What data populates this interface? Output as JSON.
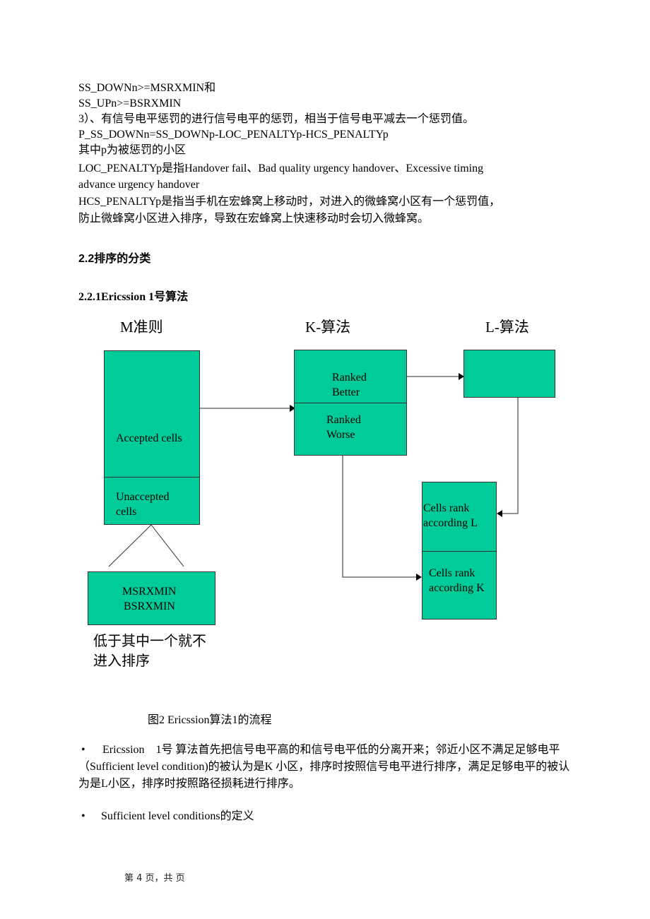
{
  "text_lines": [
    "SS_DOWNn>=MSRXMIN和",
    "SS_UPn>=BSRXMIN",
    "3）、有信号电平惩罚的进行信号电平的惩罚，相当于信号电平减去一个惩罚值。",
    "P_SS_DOWNn=SS_DOWNp-LOC_PENALTYp-HCS_PENALTYp",
    "其中p为被惩罚的小区",
    "LOC_PENALTYp是指Handover fail、Bad quality urgency handover、Excessive timing",
    "advance urgency handover",
    "HCS_PENALTYp是指当手机在宏蜂窝上移动时，对进入的微蜂窝小区有一个惩罚值，",
    "防止微蜂窝小区进入排序，导致在宏蜂窝上快速移动时会切入微蜂窝。"
  ],
  "section_heading": "2.2排序的分类",
  "subsection_heading": "2.2.1Ericssion 1号算法",
  "diagram": {
    "fill_color": "#00cc99",
    "column_titles": {
      "m": "M准则",
      "k": "K-算法",
      "l": "L-算法"
    },
    "m_box": {
      "accepted": "Accepted cells",
      "unaccepted_1": "Unaccepted",
      "unaccepted_2": "cells"
    },
    "threshold_box": {
      "line1": "MSRXMIN",
      "line2": "BSRXMIN"
    },
    "threshold_note": {
      "line1": "低于其中一个就不",
      "line2": "进入排序"
    },
    "k_box": {
      "better_1": "Ranked",
      "better_2": "Better",
      "worse_1": "Ranked",
      "worse_2": "Worse"
    },
    "result_box": {
      "l_1": "Cells rank",
      "l_2": "according L",
      "k_1": "Cells rank",
      "k_2": "according K"
    }
  },
  "caption": "图2 Ericssion算法1的流程",
  "bullets": [
    {
      "symbol": "•",
      "text": "Ericssion　1号  算法首先把信号电平高的和信号电平低的分离开来；邻近小区不满足足够电平（Sufficient level condition)的被认为是K  小区，排序时按照信号电平进行排序，满足足够电平的被认为是L小区，排序时按照路径损耗进行排序。"
    },
    {
      "symbol": "•",
      "text": "Sufficient level conditions的定义"
    }
  ],
  "footer": "第 4 页，共   页"
}
